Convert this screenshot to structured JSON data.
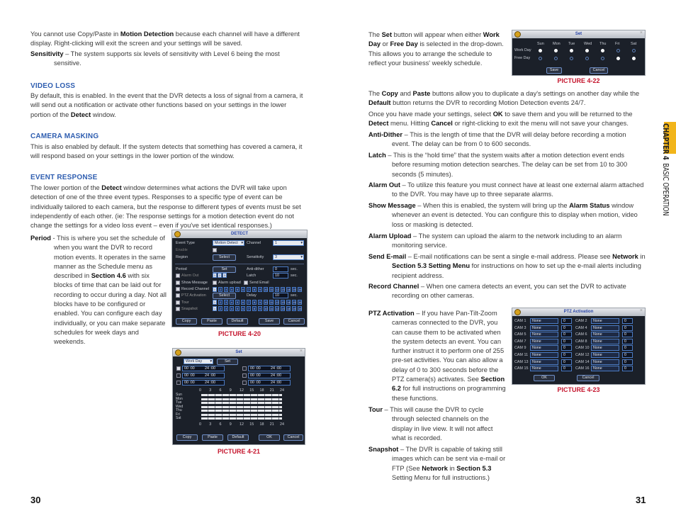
{
  "left_page": {
    "intro": [
      "You cannot use Copy/Paste in ",
      {
        "b": "Motion Detection"
      },
      " because each channel will have a different display. Right-clicking will exit the screen and your settings will be saved."
    ],
    "sensitivity": [
      {
        "b": "Sensitivity"
      },
      " – The system supports six levels of sensitivity with Level 6 being the most sensitive."
    ],
    "video_loss_heading": "VIDEO LOSS",
    "video_loss": [
      "By default, this is enabled. In the event that the DVR detects a loss of signal from a camera, it will send out a notification or activate other functions based on your settings in the lower portion of the ",
      {
        "b": "Detect"
      },
      " window."
    ],
    "camera_masking_heading": "CAMERA MASKING",
    "camera_masking": [
      "This is also enabled by default. If the system detects that something has covered a camera, it will respond based on your settings in the lower portion of the window."
    ],
    "event_response_heading": "EVENT RESPONSE",
    "event_response": [
      "The lower portion of the ",
      {
        "b": "Detect"
      },
      " window determines what actions the DVR will take upon detection of one of the three event types. Responses to a specific type of event can be individually tailored to each camera, but the response to different types of events must be set independently of each other. (ie: The response settings for a motion detection event do not change the settings for a video loss event – even if you've set identical responses.)"
    ],
    "period": [
      {
        "b": "Period"
      },
      " - This is where you set the schedule of when you want the DVR to record motion events. It operates in the same manner as the Schedule menu as described in ",
      {
        "b": "Section 4.6"
      },
      " with six blocks of time that can be laid out for recording to occur during a day. Not all blocks have to be configured or enabled. You can configure each day individually, or you can make separate schedules for week days and weekends."
    ],
    "caption_20": "PICTURE 4-20",
    "caption_21": "PICTURE 4-21",
    "page_number": "30"
  },
  "right_page": {
    "set_button": [
      "The ",
      {
        "b": "Set"
      },
      " button will appear when either ",
      {
        "b": "Work Day"
      },
      " or ",
      {
        "b": "Free Day"
      },
      " is selected in the drop-down. This allows you to arrange the schedule to reflect your business' weekly schedule."
    ],
    "caption_22": "PICTURE 4-22",
    "copy_paste": [
      "The ",
      {
        "b": "Copy"
      },
      " and ",
      {
        "b": "Paste"
      },
      " buttons allow you to duplicate a day's settings on another day while the ",
      {
        "b": "Default"
      },
      " button returns the DVR to recording Motion Detection events 24/7."
    ],
    "once": [
      "Once you have made your settings, select ",
      {
        "b": "OK"
      },
      " to save them and you will be returned to the ",
      {
        "b": "Detect"
      },
      " menu. Hitting ",
      {
        "b": "Cancel"
      },
      " or right-clicking to exit the menu will not save your changes."
    ],
    "anti_dither": [
      {
        "b": "Anti-Dither"
      },
      " – This is the length of time that the DVR will delay before recording a motion event. The delay can be from 0 to 600 seconds."
    ],
    "latch": [
      {
        "b": "Latch"
      },
      " – This is the “hold time” that the system waits after a motion detection event ends before resuming motion detection searches. The delay can be set from 10 to 300 seconds (5 minutes)."
    ],
    "alarm_out": [
      {
        "b": "Alarm Out"
      },
      " – To utilize this feature you must connect have at least one external alarm attached to the DVR. You may have up to three separate alarms."
    ],
    "show_message": [
      {
        "b": "Show Message"
      },
      " – When this is enabled, the system will bring up the ",
      {
        "b": "Alarm Status"
      },
      " window whenever an event is detected. You can configure this to display when motion, video loss or masking is detected."
    ],
    "alarm_upload": [
      {
        "b": "Alarm Upload"
      },
      " – The system can upload the alarm to the network including to an alarm monitoring service."
    ],
    "send_email": [
      {
        "b": "Send E-mail"
      },
      " – E-mail notifications can be sent a single e-mail address. Please see ",
      {
        "b": "Network"
      },
      " in ",
      {
        "b": "Section 5.3 Setting Menu"
      },
      " for instructions on how to set up the e-mail alerts including recipient address."
    ],
    "record_channel": [
      {
        "b": "Record Channel"
      },
      " – When one camera detects an event, you can set the DVR to activate recording on other cameras."
    ],
    "ptz": [
      {
        "b": "PTZ Activation"
      },
      " – If you have Pan-Tilt-Zoom cameras connected to the DVR, you can cause them to be activated when the system detects an event. You can further instruct it to perform one of 255 pre-set activities. You can also allow a delay of 0 to 300 seconds before the PTZ camera(s) activates. See ",
      {
        "b": "Section 6.2"
      },
      " for full instructions on programming these functions."
    ],
    "caption_23": "PICTURE 4-23",
    "tour": [
      {
        "b": "Tour"
      },
      " – This will cause the DVR to cycle through selected channels on the display in live view. It will not affect what is recorded."
    ],
    "snapshot": [
      {
        "b": "Snapshot"
      },
      " – The DVR is capable of taking still images which can be sent via e-mail or FTP (See ",
      {
        "b": "Network"
      },
      " in ",
      {
        "b": "Section 5.3"
      },
      " Setting Menu for full instructions.)"
    ],
    "page_number": "31",
    "chapter_tab": {
      "chapter": "CHAPTER 4",
      "title": "BASIC OPERATION",
      "color": "#f2b51a"
    }
  },
  "detect_dialog": {
    "title": "DETECT",
    "event_type_label": "Event Type",
    "event_type_value": "Motion Detect",
    "channel_label": "Channel",
    "channel_value": "1",
    "enable_label": "Enable",
    "region_label": "Region",
    "select": "Select",
    "sensitivity_label": "Sensitivity",
    "sensitivity_value": "3",
    "period_label": "Period",
    "set": "Set",
    "anti_dither_label": "Anti-dither",
    "anti_dither_value": "0",
    "sec": "sec.",
    "alarm_out_label": "Alarm Out",
    "alarm_outs": [
      "1",
      "2",
      "3"
    ],
    "latch_label": "Latch",
    "latch_value": "10",
    "show_message": "Show Message",
    "alarm_upload": "Alarm upload",
    "send_email": "Send Email",
    "record_channel": "Record Channel",
    "ptz_activation": "PTZ Activation",
    "delay_label": "Delay",
    "delay_value": "10",
    "tour": "Tour",
    "snapshot": "Snapshot",
    "channels": [
      "1",
      "2",
      "3",
      "4",
      "5",
      "6",
      "7",
      "8",
      "9",
      "10",
      "11",
      "12",
      "13",
      "14",
      "15",
      "16"
    ],
    "buttons": {
      "copy": "Copy",
      "paste": "Paste",
      "default": "Default",
      "save": "Save",
      "cancel": "Cancel"
    }
  },
  "set_dialog": {
    "title": "Set",
    "day_type": "Work Day",
    "set": "Set",
    "periods": [
      {
        "start": "00 :00",
        "end": "24 :00"
      },
      {
        "start": "00 :00",
        "end": "24 :00"
      },
      {
        "start": "00 :00",
        "end": "24 :00"
      },
      {
        "start": "00 :00",
        "end": "24 :00"
      },
      {
        "start": "00 :00",
        "end": "24 :00"
      },
      {
        "start": "00 :00",
        "end": "24 :00"
      }
    ],
    "hours": [
      "0",
      "3",
      "6",
      "9",
      "12",
      "15",
      "18",
      "21",
      "24"
    ],
    "days": [
      "Sun",
      "Mon",
      "Tue",
      "Wed",
      "Thu",
      "Fri",
      "Sat"
    ],
    "buttons": {
      "copy": "Copy",
      "paste": "Paste",
      "default": "Default",
      "ok": "OK",
      "cancel": "Cancel"
    }
  },
  "weekday_dialog": {
    "title": "Set",
    "days": [
      "Sun",
      "Mon",
      "Tue",
      "Wed",
      "Thu",
      "Fri",
      "Sat"
    ],
    "work_day_label": "Work Day",
    "free_day_label": "Free Day",
    "work_day": [
      true,
      true,
      true,
      true,
      true,
      false,
      false
    ],
    "free_day": [
      false,
      false,
      false,
      false,
      false,
      true,
      true
    ],
    "save": "Save",
    "cancel": "Cancel"
  },
  "ptz_dialog": {
    "title": "PTZ Activation",
    "cams": [
      {
        "cam": "CAM 1",
        "mode": "None",
        "value": "0"
      },
      {
        "cam": "CAM 2",
        "mode": "None",
        "value": "0"
      },
      {
        "cam": "CAM 3",
        "mode": "None",
        "value": "0"
      },
      {
        "cam": "CAM 4",
        "mode": "None",
        "value": "0"
      },
      {
        "cam": "CAM 5",
        "mode": "None",
        "value": "0"
      },
      {
        "cam": "CAM 6",
        "mode": "None",
        "value": "0"
      },
      {
        "cam": "CAM 7",
        "mode": "None",
        "value": "0"
      },
      {
        "cam": "CAM 8",
        "mode": "None",
        "value": "0"
      },
      {
        "cam": "CAM 9",
        "mode": "None",
        "value": "0"
      },
      {
        "cam": "CAM 10",
        "mode": "None",
        "value": "0"
      },
      {
        "cam": "CAM 11",
        "mode": "None",
        "value": "0"
      },
      {
        "cam": "CAM 12",
        "mode": "None",
        "value": "0"
      },
      {
        "cam": "CAM 13",
        "mode": "None",
        "value": "0"
      },
      {
        "cam": "CAM 14",
        "mode": "None",
        "value": "0"
      },
      {
        "cam": "CAM 15",
        "mode": "None",
        "value": "0"
      },
      {
        "cam": "CAM 16",
        "mode": "None",
        "value": "0"
      }
    ],
    "ok": "OK",
    "cancel": "Cancel"
  }
}
